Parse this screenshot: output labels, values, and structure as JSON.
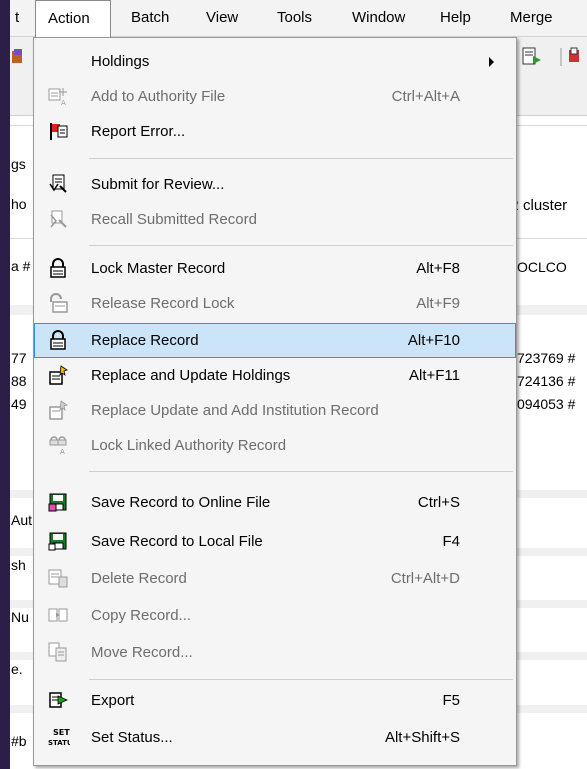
{
  "menubar": {
    "items": [
      "t",
      "Action",
      "Batch",
      "View",
      "Tools",
      "Window",
      "Help",
      "Merge"
    ]
  },
  "background": {
    "left_fragments": [
      "gs",
      "ho",
      "a #",
      "77",
      "88",
      "49",
      "Aut",
      "sh",
      "Nu",
      "e.",
      "#b"
    ],
    "right_fragments": [
      "R cluster",
      "OCLCO",
      "723769 #",
      "724136 #",
      "094053 #"
    ]
  },
  "menu": {
    "items": [
      {
        "label": "Holdings",
        "shortcut": "",
        "submenu": true,
        "enabled": true,
        "icon": "none"
      },
      {
        "label": "Add to Authority File",
        "shortcut": "Ctrl+Alt+A",
        "enabled": false,
        "icon": "add-authority-icon"
      },
      {
        "label": "Report Error...",
        "shortcut": "",
        "enabled": true,
        "icon": "report-error-flag-icon"
      },
      {
        "label": "Submit for Review...",
        "shortcut": "",
        "enabled": true,
        "icon": "submit-review-icon"
      },
      {
        "label": "Recall Submitted Record",
        "shortcut": "",
        "enabled": false,
        "icon": "recall-record-icon"
      },
      {
        "label": "Lock Master Record",
        "shortcut": "Alt+F8",
        "enabled": true,
        "icon": "lock-icon"
      },
      {
        "label": "Release Record Lock",
        "shortcut": "Alt+F9",
        "enabled": false,
        "icon": "unlock-icon"
      },
      {
        "label": "Replace Record",
        "shortcut": "Alt+F10",
        "enabled": true,
        "highlighted": true,
        "icon": "replace-record-icon"
      },
      {
        "label": "Replace and Update Holdings",
        "shortcut": "Alt+F11",
        "enabled": true,
        "icon": "replace-update-icon"
      },
      {
        "label": "Replace Update and Add Institution Record",
        "shortcut": "",
        "enabled": false,
        "icon": "replace-institution-icon"
      },
      {
        "label": "Lock Linked Authority Record",
        "shortcut": "",
        "enabled": false,
        "icon": "lock-authority-icon"
      },
      {
        "label": "Save Record to Online File",
        "shortcut": "Ctrl+S",
        "enabled": true,
        "icon": "save-online-icon"
      },
      {
        "label": "Save Record to Local File",
        "shortcut": "F4",
        "enabled": true,
        "icon": "save-local-icon"
      },
      {
        "label": "Delete Record",
        "shortcut": "Ctrl+Alt+D",
        "enabled": false,
        "icon": "delete-record-icon"
      },
      {
        "label": "Copy Record...",
        "shortcut": "",
        "enabled": false,
        "icon": "copy-record-icon"
      },
      {
        "label": "Move Record...",
        "shortcut": "",
        "enabled": false,
        "icon": "move-record-icon"
      },
      {
        "label": "Export",
        "shortcut": "F5",
        "enabled": true,
        "icon": "export-icon"
      },
      {
        "label": "Set Status...",
        "shortcut": "Alt+Shift+S",
        "enabled": true,
        "icon": "set-status-icon",
        "icon_text": "SET STATUS"
      }
    ]
  },
  "colors": {
    "highlight_bg": "#cce4f7",
    "highlight_border": "#3a8ee6",
    "disabled_text": "#6d6d6d",
    "window_frame": "#2a1a44"
  }
}
